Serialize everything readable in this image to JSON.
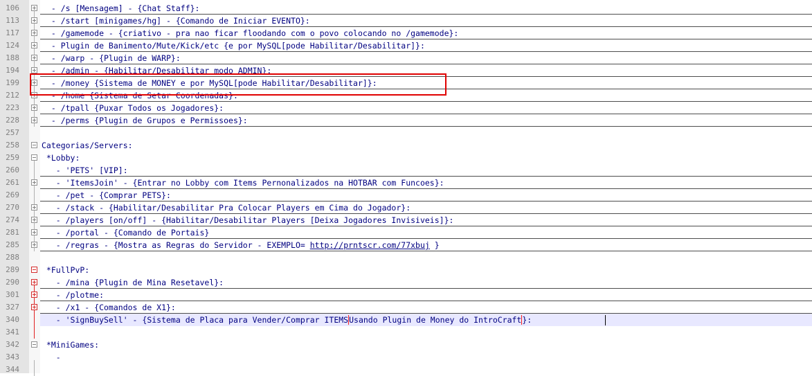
{
  "editor": {
    "lines": [
      {
        "num": "106",
        "text": "  - /s [Mensagem] - {Chat Staff}:",
        "fold": "plus",
        "underline": true
      },
      {
        "num": "113",
        "text": "  - /start [minigames/hg] - {Comando de Iniciar EVENTO}:",
        "fold": "plus",
        "underline": true
      },
      {
        "num": "117",
        "text": "  - /gamemode - {criativo - pra nao ficar floodando com o povo colocando no /gamemode}:",
        "fold": "plus",
        "underline": true
      },
      {
        "num": "124",
        "text": "  - Plugin de Banimento/Mute/Kick/etc {e por MySQL[pode Habilitar/Desabilitar]}:",
        "fold": "plus",
        "underline": true
      },
      {
        "num": "188",
        "text": "  - /warp - {Plugin de WARP}:",
        "fold": "plus",
        "underline": true
      },
      {
        "num": "194",
        "text": "  - /admin - {Habilitar/Desabilitar modo ADMIN}:",
        "fold": "plus",
        "underline": true
      },
      {
        "num": "199",
        "text": "  - /money {Sistema de MONEY e por MySQL[pode Habilitar/Desabilitar]}:",
        "fold": "plus",
        "underline": true
      },
      {
        "num": "212",
        "text": "  - /home {Sistema de Setar Coordenadas}:",
        "fold": "plus",
        "underline": true
      },
      {
        "num": "223",
        "text": "  - /tpall {Puxar Todos os Jogadores}:",
        "fold": "plus",
        "underline": true
      },
      {
        "num": "228",
        "text": "  - /perms {Plugin de Grupos e Permissoes}:",
        "fold": "plus",
        "underline": true
      },
      {
        "num": "257",
        "text": "",
        "fold": "",
        "underline": false
      },
      {
        "num": "258",
        "text": "Categorias/Servers:",
        "fold": "minus",
        "underline": false
      },
      {
        "num": "259",
        "text": " *Lobby:",
        "fold": "minus",
        "underline": false
      },
      {
        "num": "260",
        "text": "   - 'PETS' [VIP]:",
        "fold": "",
        "underline": true
      },
      {
        "num": "261",
        "text": "   - 'ItemsJoin' - {Entrar no Lobby com Items Pernonalizados na HOTBAR com Funcoes}:",
        "fold": "plus",
        "underline": true
      },
      {
        "num": "269",
        "text": "   - /pet - {Comprar PETS}:",
        "fold": "",
        "underline": true
      },
      {
        "num": "270",
        "text": "   - /stack - {Habilitar/Desabilitar Pra Colocar Players em Cima do Jogador}:",
        "fold": "plus",
        "underline": true
      },
      {
        "num": "274",
        "text": "   - /players [on/off] - {Habilitar/Desabilitar Players [Deixa Jogadores Invisiveis]}:",
        "fold": "plus",
        "underline": true
      },
      {
        "num": "281",
        "text": "   - /portal - {Comando de Portais}",
        "fold": "plus",
        "underline": true
      },
      {
        "num": "285",
        "text": "   - /regras - {Mostra as Regras do Servidor - EXEMPLO= ",
        "url": "http://prntscr.com/77xbuj",
        "after": " }",
        "fold": "plus",
        "underline": true
      },
      {
        "num": "288",
        "text": "",
        "fold": "",
        "underline": false
      },
      {
        "num": "289",
        "text": " *FullPvP:",
        "fold": "minus-red",
        "underline": false
      },
      {
        "num": "290",
        "text": "   - /mina {Plugin de Mina Resetavel}:",
        "fold": "plus-red",
        "underline": true
      },
      {
        "num": "301",
        "text": "   - /plotme:",
        "fold": "plus-red",
        "underline": true
      },
      {
        "num": "327",
        "text": "   - /x1 - {Comandos de X1}:",
        "fold": "plus-red",
        "underline": true
      },
      {
        "num": "340",
        "text": "   - 'SignBuySell' - {Sistema de Placa para Vender/Comprar ITEMS",
        "bracketed": "Usando Plugin de Money do IntroCraft",
        "after": "}:",
        "fold": "",
        "underline": false,
        "highlight": true
      },
      {
        "num": "341",
        "text": "",
        "fold": "",
        "underline": false
      },
      {
        "num": "342",
        "text": " *MiniGames:",
        "fold": "minus",
        "underline": false
      },
      {
        "num": "343",
        "text": "   -",
        "fold": "",
        "underline": false
      },
      {
        "num": "344",
        "text": "",
        "fold": "",
        "underline": false
      }
    ]
  },
  "colors": {
    "text": "#000080",
    "line_numbers": "#7f7f7f",
    "gutter": "#e4e4e4",
    "highlight_line": "#e8e8ff",
    "annotation": "#e00000"
  }
}
